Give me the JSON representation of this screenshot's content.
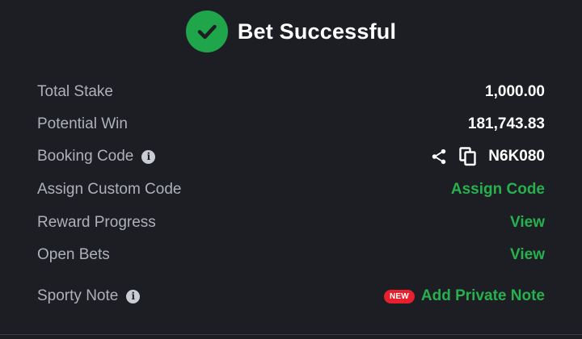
{
  "header": {
    "title": "Bet Successful",
    "icon": "check-circle-icon",
    "accent": "#1fa64a"
  },
  "rows": {
    "total_stake": {
      "label": "Total Stake",
      "value": "1,000.00"
    },
    "potential_win": {
      "label": "Potential Win",
      "value": "181,743.83"
    },
    "booking_code": {
      "label": "Booking Code",
      "value": "N6K080",
      "icons": [
        "info-icon",
        "share-icon",
        "copy-icon"
      ]
    },
    "custom_code": {
      "label": "Assign Custom Code",
      "action": "Assign Code"
    },
    "reward_progress": {
      "label": "Reward Progress",
      "action": "View"
    },
    "open_bets": {
      "label": "Open Bets",
      "action": "View"
    },
    "sporty_note": {
      "label": "Sporty Note",
      "badge": "NEW",
      "action": "Add Private Note"
    }
  },
  "colors": {
    "background": "#1c1e24",
    "link": "#27b04e",
    "badge": "#e8202e",
    "label": "#aeb1b8"
  }
}
